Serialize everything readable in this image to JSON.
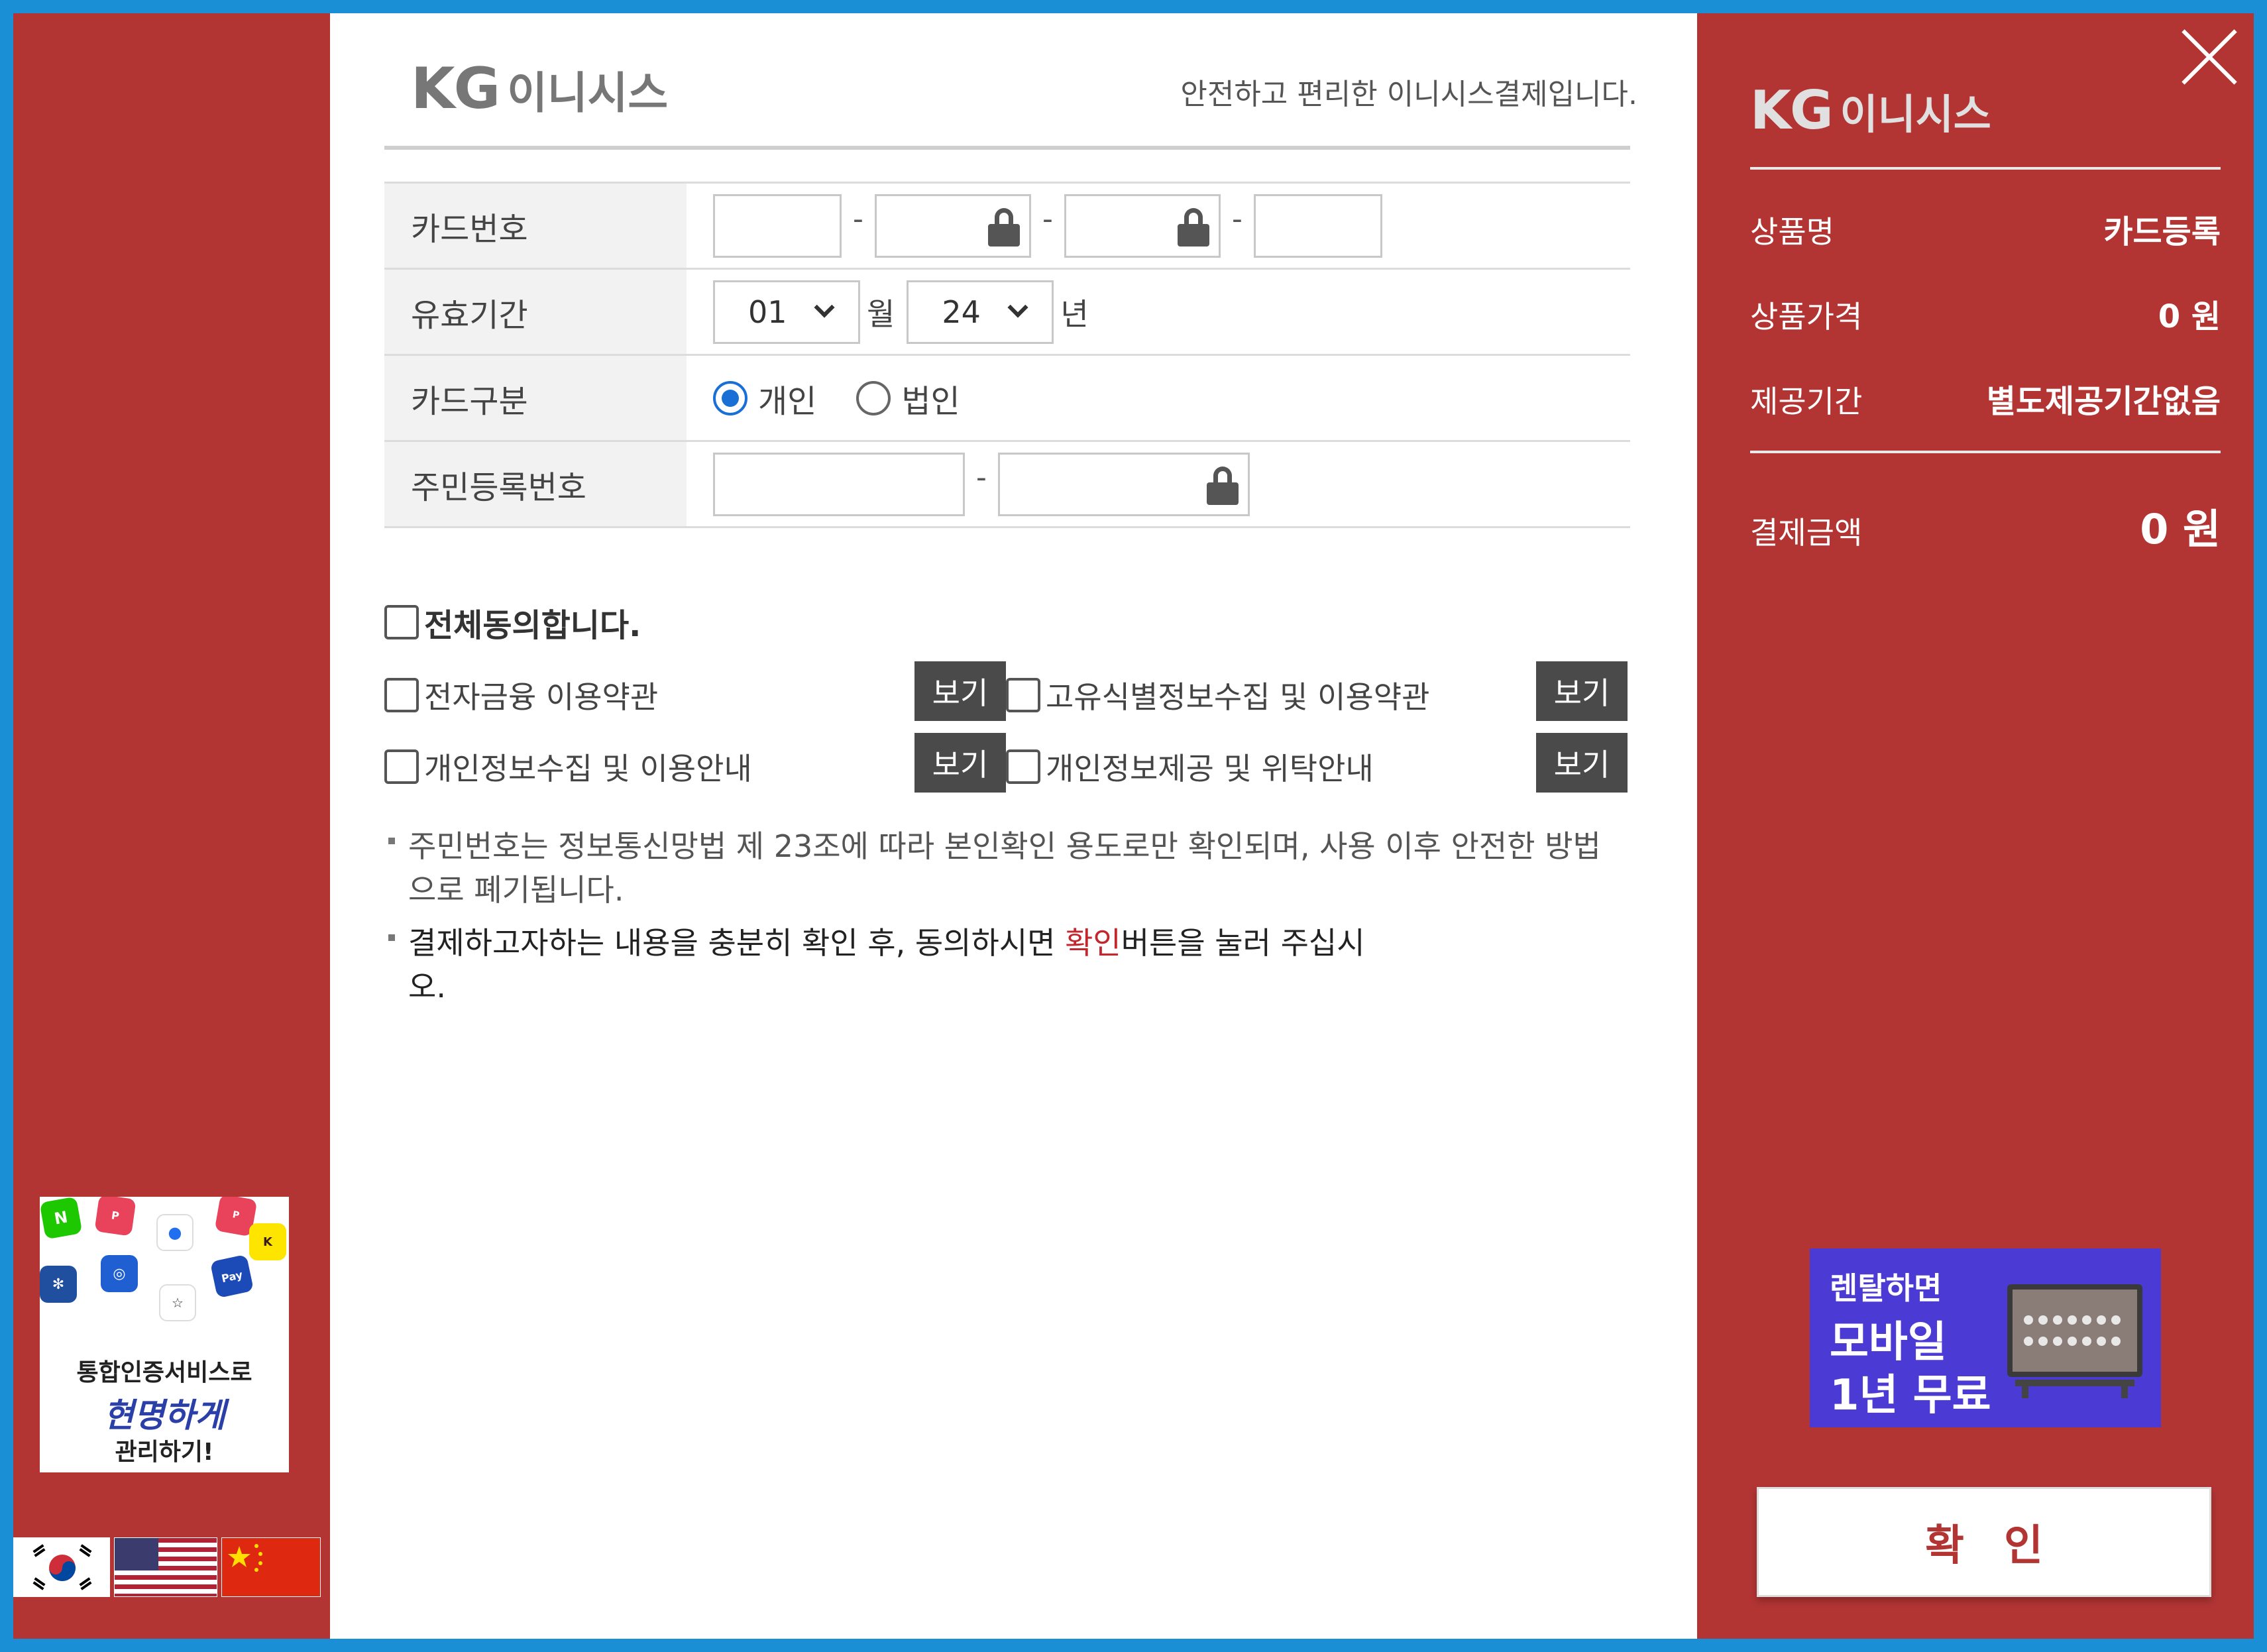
{
  "brand": {
    "kg": "KG",
    "name": "이니시스"
  },
  "header": {
    "tagline": "안전하고 편리한 이니시스결제입니다."
  },
  "form": {
    "card_number_label": "카드번호",
    "separator": "-",
    "expiry_label": "유효기간",
    "expiry_month": "01",
    "month_unit": "월",
    "expiry_year": "24",
    "year_unit": "년",
    "card_type_label": "카드구분",
    "card_type_personal": "개인",
    "card_type_corporate": "법인",
    "resident_label": "주민등록번호"
  },
  "agreements": {
    "all_label": "전체동의합니다.",
    "view_label": "보기",
    "items": [
      "전자금융 이용약관",
      "고유식별정보수집 및 이용약관",
      "개인정보수집 및 이용안내",
      "개인정보제공 및 위탁안내"
    ]
  },
  "notes": {
    "first": "주민번호는 정보통신망법 제 23조에 따라 본인확인 용도로만 확인되며, 사용 이후 안전한 방법으로 폐기됩니다.",
    "second_before": "결제하고자하는 내용을 충분히 확인 후, 동의하시면 ",
    "second_highlight": "확인",
    "second_after": "버튼을 눌러 주십시오."
  },
  "summary": {
    "product_name_label": "상품명",
    "product_name": "카드등록",
    "price_label": "상품가격",
    "price": "0 원",
    "period_label": "제공기간",
    "period": "별도제공기간없음",
    "total_label": "결제금액",
    "total": "0 원"
  },
  "promo": {
    "line1": "통합인증서비스로",
    "line2": "현명하게",
    "line3": "관리하기!"
  },
  "banner": {
    "line1": "렌탈하면",
    "line2": "모바일",
    "line3": "1년 무료"
  },
  "confirm_label": "확인",
  "colors": {
    "brand_red": "#b23534",
    "accent_blue": "#1a6fd6",
    "button_dark": "#4a4a4a",
    "banner_purple": "#4c3ad4"
  }
}
